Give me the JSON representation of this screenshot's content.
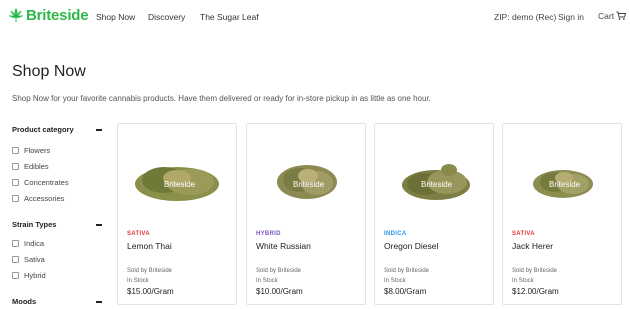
{
  "brand": {
    "name": "Briteside",
    "color": "#2db84b"
  },
  "nav": {
    "shop_now": "Shop Now",
    "discovery": "Discovery",
    "sugar_leaf": "The Sugar Leaf"
  },
  "header": {
    "zip": "ZIP: demo (Rec)",
    "sign_in": "Sign in",
    "cart": "Cart",
    "cart_icon": "shopping-cart-icon"
  },
  "page": {
    "title": "Shop Now",
    "description": "Shop Now for your favorite cannabis products. Have them delivered or ready for in-store pickup in as little as one hour."
  },
  "filters": {
    "product_category": {
      "title": "Product category",
      "options": [
        "Flowers",
        "Edibles",
        "Concentrates",
        "Accessories"
      ]
    },
    "strain_types": {
      "title": "Strain Types",
      "options": [
        "Indica",
        "Sativa",
        "Hybrid"
      ]
    },
    "moods": {
      "title": "Moods"
    }
  },
  "products": [
    {
      "strain": "SATIVA",
      "strain_color": "#e53935",
      "name": "Lemon Thai",
      "seller": "Sold by Briteside",
      "stock": "In Stock",
      "price": "$15.00/Gram",
      "watermark": "Briteside"
    },
    {
      "strain": "HYBRID",
      "strain_color": "#7e57c2",
      "name": "White Russian",
      "seller": "Sold by Briteside",
      "stock": "In Stock",
      "price": "$10.00/Gram",
      "watermark": "Briteside"
    },
    {
      "strain": "INDICA",
      "strain_color": "#2196f3",
      "name": "Oregon Diesel",
      "seller": "Sold by Briteside",
      "stock": "In Stock",
      "price": "$8.00/Gram",
      "watermark": "Briteside"
    },
    {
      "strain": "SATIVA",
      "strain_color": "#e53935",
      "name": "Jack Herer",
      "seller": "Sold by Briteside",
      "stock": "In Stock",
      "price": "$12.00/Gram",
      "watermark": "Briteside"
    }
  ]
}
